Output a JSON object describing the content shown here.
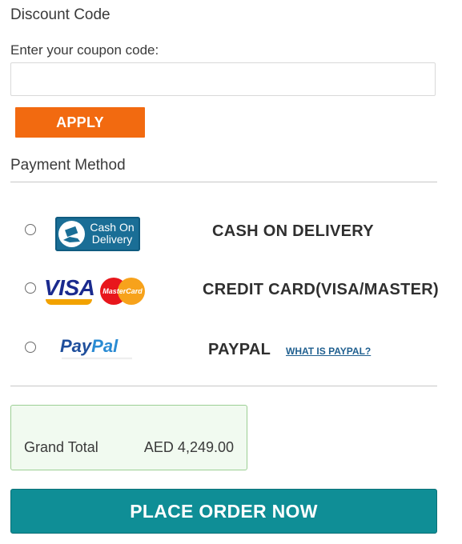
{
  "discount": {
    "title": "Discount Code",
    "coupon_label": "Enter your coupon code:",
    "coupon_value": "",
    "coupon_placeholder": "",
    "apply_label": "APPLY"
  },
  "payment": {
    "title": "Payment Method",
    "methods": [
      {
        "label": "CASH ON DELIVERY",
        "logo_text": "Cash On Delivery",
        "selected": false
      },
      {
        "label": "CREDIT CARD(VISA/MASTER)",
        "logo_text_visa": "VISA",
        "logo_text_mc": "MasterCard",
        "selected": false
      },
      {
        "label": "PAYPAL",
        "logo_text_pay": "Pay",
        "logo_text_pal": "Pal",
        "selected": false,
        "link": "WHAT IS PAYPAL?"
      }
    ]
  },
  "total": {
    "label": "Grand Total",
    "value": "AED 4,249.00"
  },
  "place_order_label": "PLACE ORDER NOW",
  "colors": {
    "apply_button": "#f26a10",
    "place_order_button": "#0f8e96",
    "total_box_bg": "#f1faf0",
    "total_box_border": "#9ccf94"
  }
}
